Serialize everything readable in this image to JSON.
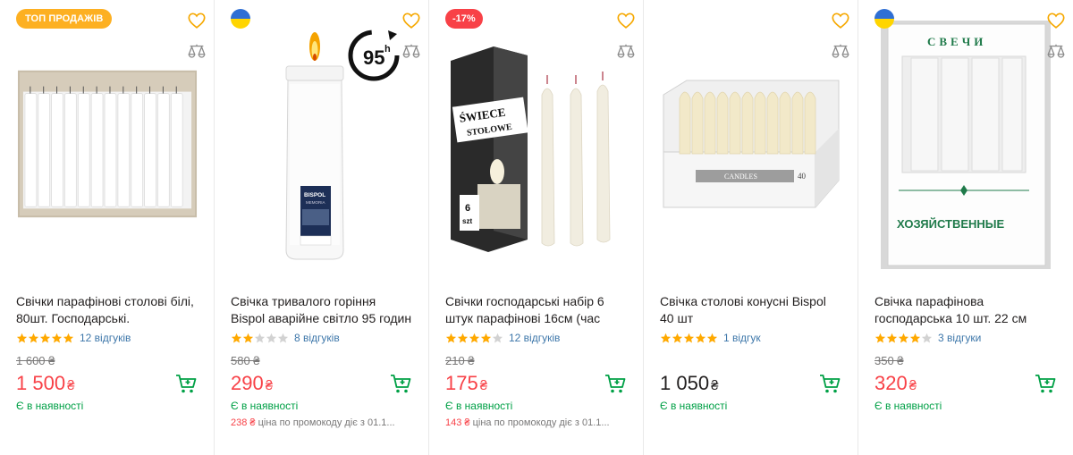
{
  "products": [
    {
      "badge": "ТОП ПРОДАЖІВ",
      "title": "Свічки парафінові столові білі, 80шт. Господарські.",
      "reviews": "12 відгуків",
      "rating": 5,
      "old_price": "1 600 ₴",
      "price": "1 500",
      "currency": "₴",
      "stock": "Є в наявності",
      "image": "box-of-white-candles"
    },
    {
      "title": "Свічка тривалого горіння Bispol аварійне світло 95 годин",
      "reviews": "8 відгуків",
      "rating": 2,
      "old_price": "580 ₴",
      "price": "290",
      "currency": "₴",
      "stock": "Є в наявності",
      "promo_price": "238 ₴",
      "promo_text": " ціна по промокоду діє з 01.1...",
      "image": "bispol-jar-candle",
      "label_95": "95",
      "label_h": "h"
    },
    {
      "badge": "-17%",
      "title": "Свічки господарські набір 6 штук парафінові 16см (час",
      "reviews": "12 відгуків",
      "rating": 4,
      "old_price": "210 ₴",
      "price": "175",
      "currency": "₴",
      "stock": "Є в наявності",
      "promo_price": "143 ₴",
      "promo_text": " ціна по промокоду діє з 01.1...",
      "image": "swiece-stolowe-pack",
      "pack_text": "ŚWIECE",
      "pack_text2": "STOŁOWE",
      "pack_count": "6",
      "pack_unit": "szt"
    },
    {
      "title": "Свічка столові конусні Bispol 40 шт",
      "reviews": "1 відгук",
      "rating": 5,
      "price": "1 050",
      "currency": "₴",
      "stock": "Є в наявності",
      "image": "cone-candles-box",
      "box_label": "CANDLES",
      "box_count": "40"
    },
    {
      "title": "Свічка парафінова господарська 10 шт. 22 см",
      "reviews": "3 відгуки",
      "rating": 4,
      "old_price": "350 ₴",
      "price": "320",
      "currency": "₴",
      "stock": "Є в наявності",
      "image": "household-candles-box",
      "box_top": "СВЕЧИ",
      "box_bottom": "ХОЗЯЙСТВЕННЫЕ"
    }
  ],
  "colors": {
    "accent_orange": "#fdb022",
    "sale_red": "#f84147",
    "green": "#00a046",
    "link_blue": "#3e77aa",
    "star": "#ffa900"
  }
}
